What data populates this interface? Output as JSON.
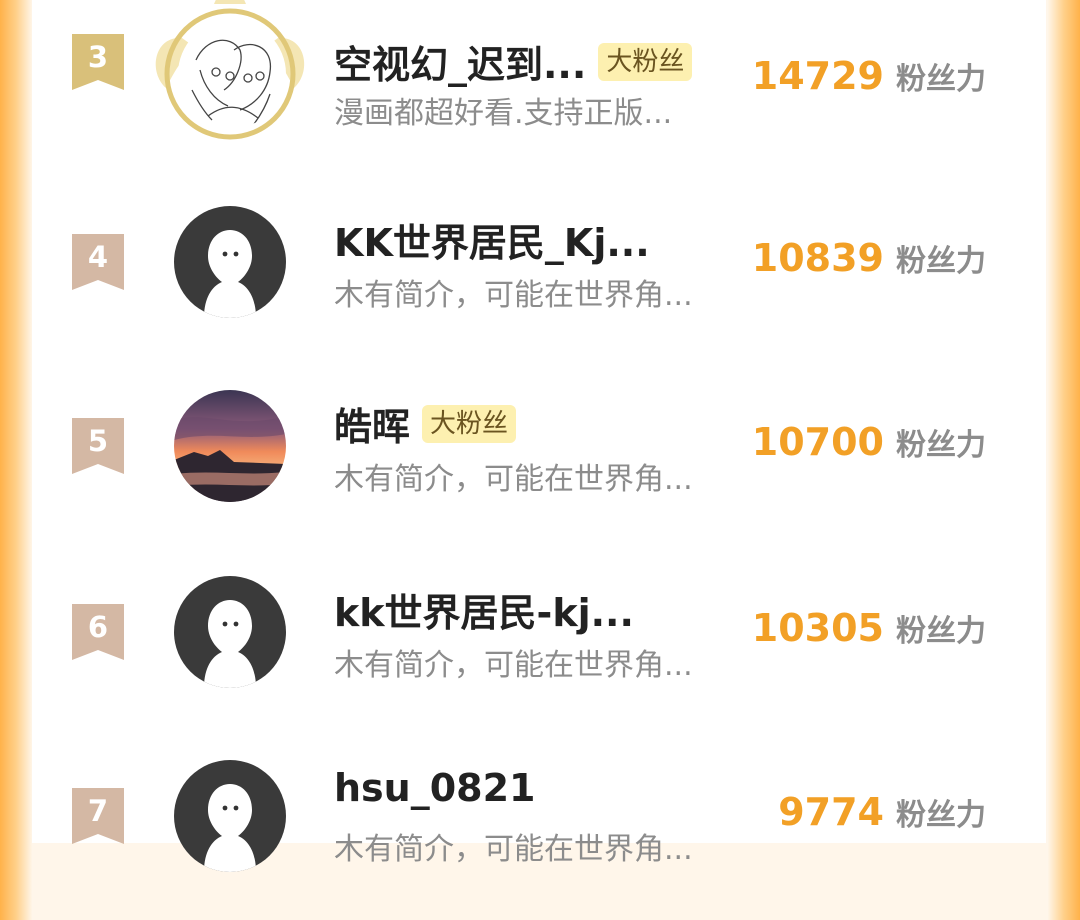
{
  "unit_label": "粉丝力",
  "rows": [
    {
      "rank": "3",
      "name": "空视幻_迟到...",
      "tag": "大粉丝",
      "bio": "漫画都超好看.支持正版...",
      "score": "14729",
      "avatar": "anime-drawing",
      "special_frame": true
    },
    {
      "rank": "4",
      "name": "KK世界居民_Kj...",
      "tag": "",
      "bio": "木有简介，可能在世界角...",
      "score": "10839",
      "avatar": "default",
      "special_frame": false
    },
    {
      "rank": "5",
      "name": "皓晖",
      "tag": "大粉丝",
      "bio": "木有简介，可能在世界角...",
      "score": "10700",
      "avatar": "sunset-photo",
      "special_frame": false
    },
    {
      "rank": "6",
      "name": "kk世界居民-kj...",
      "tag": "",
      "bio": "木有简介，可能在世界角...",
      "score": "10305",
      "avatar": "default",
      "special_frame": false
    },
    {
      "rank": "7",
      "name": "hsu_0821",
      "tag": "",
      "bio": "木有简介，可能在世界角...",
      "score": "9774",
      "avatar": "default",
      "special_frame": false
    }
  ],
  "colors": {
    "score": "#f2a026",
    "rank3_badge": "#d9c07a",
    "rank_badge": "#d4b8a4",
    "tag_bg": "#fdf0b0"
  }
}
